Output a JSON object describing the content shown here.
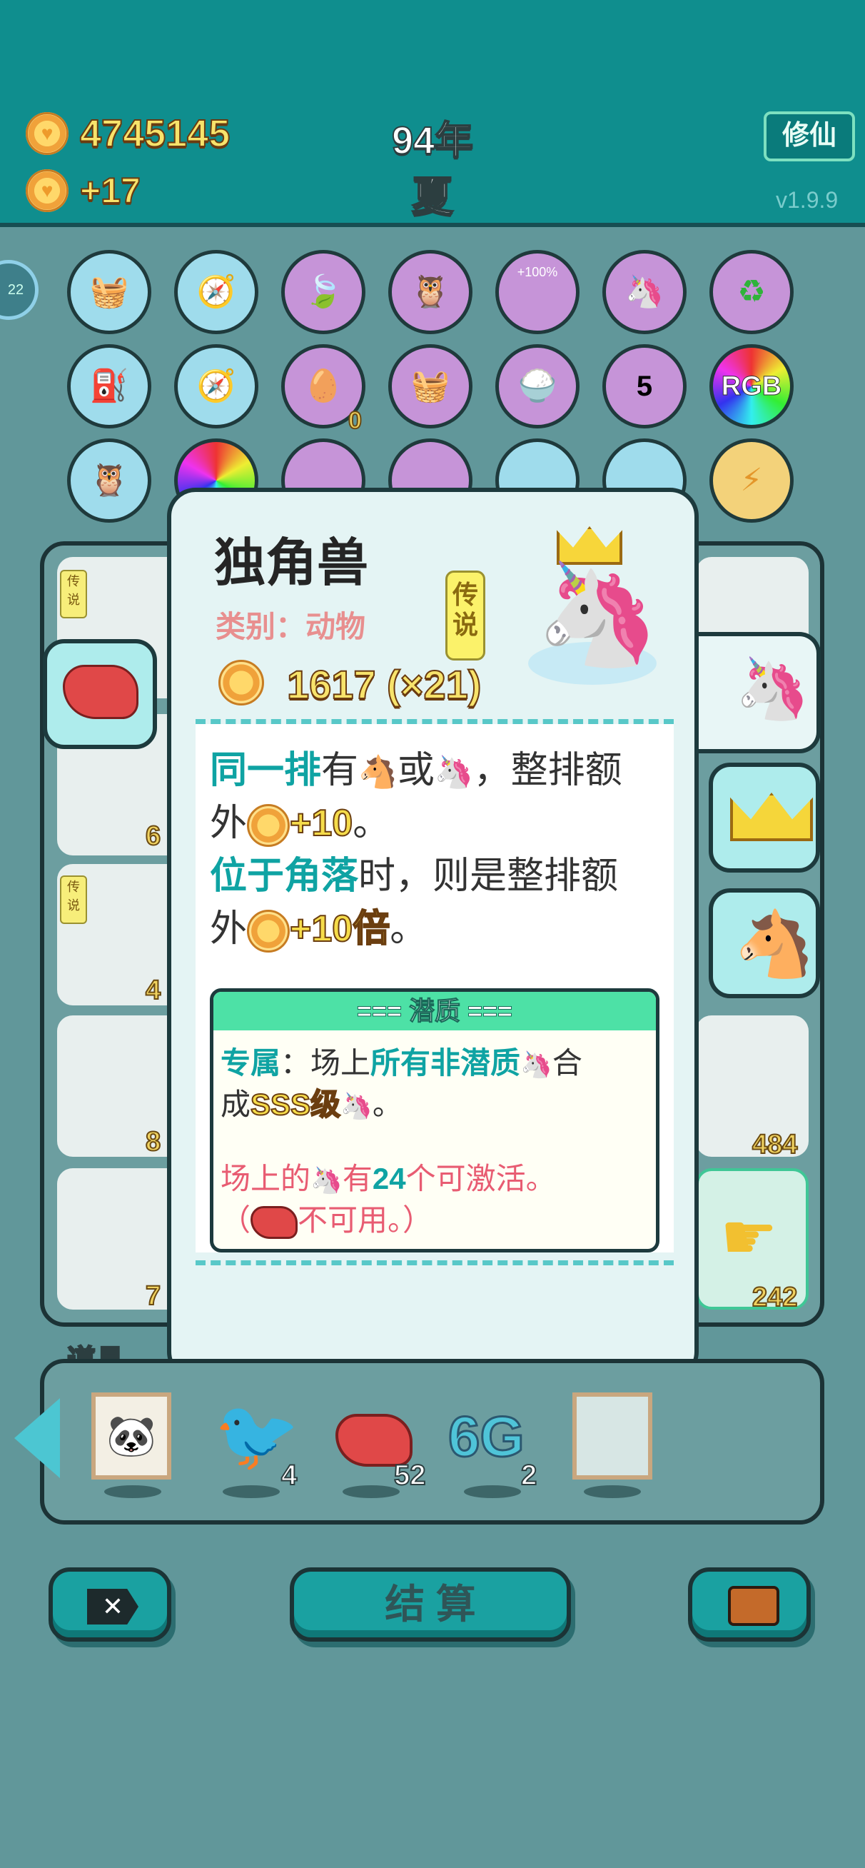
{
  "header": {
    "coins_total": "4745145",
    "coins_income": "+17",
    "year": "94年",
    "season": "夏",
    "cultivate_button": "修仙",
    "version": "v1.9.9",
    "round_counter": "22"
  },
  "board": {
    "slot_row1_icons": [
      "basket-icon",
      "compass-icon",
      "leaf-icon",
      "owl-icon",
      "cup-100-icon",
      "unicorn-pair-icon",
      "recycle-icon"
    ],
    "slot_row2_icons": [
      "pump-icon",
      "compass-icon",
      "egg-tray-icon",
      "basket-icon",
      "rice-bowl-icon",
      "calendar-icon",
      "rgb-icon"
    ],
    "slot_row3_icons": [
      "owl-icon",
      "rgb-icon",
      "leaf-icon",
      "box-icon",
      "star-icon",
      "star-icon",
      "lightning-icon"
    ],
    "cup_label": "+100%",
    "calendar_label": "5",
    "rgb_label": "RGB",
    "egg_tray_count": "0",
    "left_badges": [
      "传说",
      "传说"
    ],
    "left_counts": [
      "6",
      "4",
      "8",
      "7"
    ],
    "right_counts": [
      "484",
      "242"
    ]
  },
  "popup": {
    "title": "独角兽",
    "category": "类别：动物",
    "rarity": "传说",
    "value": "1617 (×21)",
    "desc_line1_a": "同一排",
    "desc_line1_b": "有",
    "desc_line1_c": "或",
    "desc_line1_d": "，整排额",
    "desc_line2_a": "外",
    "desc_line2_b": "+10",
    "desc_line2_c": "。",
    "desc_line3_a": "位于角落",
    "desc_line3_b": "时，则是整排额",
    "desc_line4_a": "外",
    "desc_line4_b": "+10倍",
    "desc_line4_c": "。",
    "potential_header": "=== 潜质 ===",
    "q1_a": "专属",
    "q1_b": "：场上",
    "q1_c": "所有非潜质",
    "q1_d": "合",
    "q2_a": "成",
    "q2_b": "SSS级",
    "q2_c": "。",
    "q3_a": "场上的",
    "q3_b": "有",
    "q3_c": "24",
    "q3_d": "个可激活。",
    "q4_a": "（",
    "q4_b": "不可用。）"
  },
  "items": {
    "label": "道具",
    "list": [
      {
        "icon": "panda-frame-icon",
        "count": ""
      },
      {
        "icon": "bird-icon",
        "count": "4"
      },
      {
        "icon": "liver-icon",
        "count": "52"
      },
      {
        "icon": "6g-icon",
        "text": "6G",
        "count": "2"
      },
      {
        "icon": "empty-frame-icon",
        "count": ""
      }
    ]
  },
  "actions": {
    "settle_label": "结 算"
  },
  "colors": {
    "header": "#0f8e8e",
    "board": "#61979a",
    "accent_teal": "#0fa3a3",
    "gold": "#f5dc4a"
  }
}
